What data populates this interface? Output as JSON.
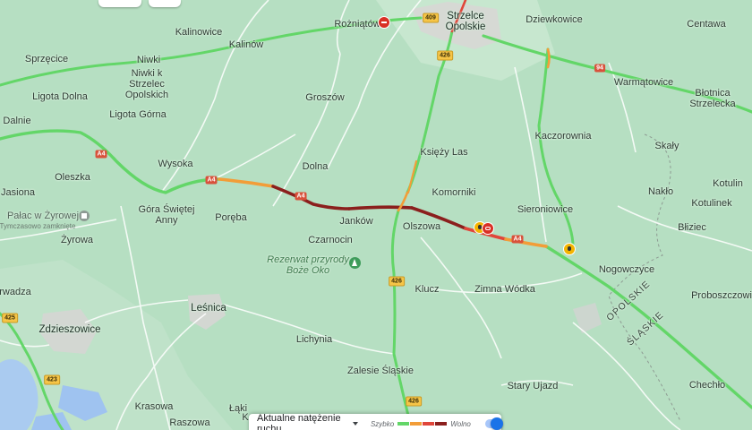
{
  "colors": {
    "fast": "#63d668",
    "medium": "#f29d38",
    "slow": "#e0463a",
    "very_slow": "#8b1f1d",
    "land": "#b6dfc2",
    "road": "#ffffff"
  },
  "places": {
    "rozniatow": "Rożniątów",
    "strzelce": "Strzelce\nOpolskie",
    "dziewkowice": "Dziewkowice",
    "centawa": "Centawa",
    "kalinowice": "Kalinowice",
    "kalinow": "Kalinów",
    "sprzecice": "Sprzęcice",
    "niwki": "Niwki",
    "niwki_k": "Niwki k\nStrzelec\nOpolskich",
    "warmatowice": "Warmątowice",
    "blotnica": "Błotnica\nStrzelecka",
    "ligota_dolna": "Ligota Dolna",
    "groszow": "Groszów",
    "dalnie": "Dalnie",
    "ligota_gorna": "Ligota Górna",
    "kaczorownia": "Kaczorownia",
    "skaly": "Skały",
    "ksiezy_las": "Księży Las",
    "wysoka": "Wysoka",
    "oleszka": "Oleszka",
    "dolna": "Dolna",
    "naklo": "Nakło",
    "kotulin": "Kotulin",
    "jasiona": "Jasiona",
    "gora_swietej_anny": "Góra Świętej\nAnny",
    "komorniki": "Komorniki",
    "kotulinek": "Kotulinek",
    "sieroniowice": "Sieroniowice",
    "poreba": "Poręba",
    "jankow": "Janków",
    "olszowa": "Olszowa",
    "zyrowa": "Żyrowa",
    "bliziec": "Błiziec",
    "czarnocin": "Czarnocin",
    "nogowczyce": "Nogowczyce",
    "klucz": "Klucz",
    "zimna_wodka": "Zimna Wódka",
    "rwadza": "rwadza",
    "proboszczowice": "Proboszczowi",
    "lesnica": "Leśnica",
    "zdzieszowice": "Zdzieszowice",
    "lichynia": "Lichynia",
    "zalesie": "Zalesie Śląskie",
    "stary_ujazd": "Stary Ujazd",
    "chechlo": "Chechło",
    "krasowa": "Krasowa",
    "raszowa": "Raszowa",
    "laki": "Łąki",
    "k": "K"
  },
  "poi": {
    "palace_name": "Pałac w Żyrowej",
    "palace_status": "Tymczasowo zamknięte",
    "nature_name": "Rezerwat przyrody\nBoże Oko"
  },
  "regions": {
    "opolskie": "OPOLSKIE",
    "slaskie": "ŚLĄSKIE"
  },
  "road_shields": {
    "a4": "A4",
    "r409": "409",
    "r426": "426",
    "r423": "423",
    "r425": "425",
    "r94": "94"
  },
  "traffic_control": {
    "selected_label": "Aktualne natężenie ruchu",
    "legend_fast": "Szybko",
    "legend_slow": "Wolno",
    "toggle_on": true
  },
  "markers": {
    "closure": "road-closed",
    "roadworks": "roadworks",
    "incident": "incident"
  }
}
